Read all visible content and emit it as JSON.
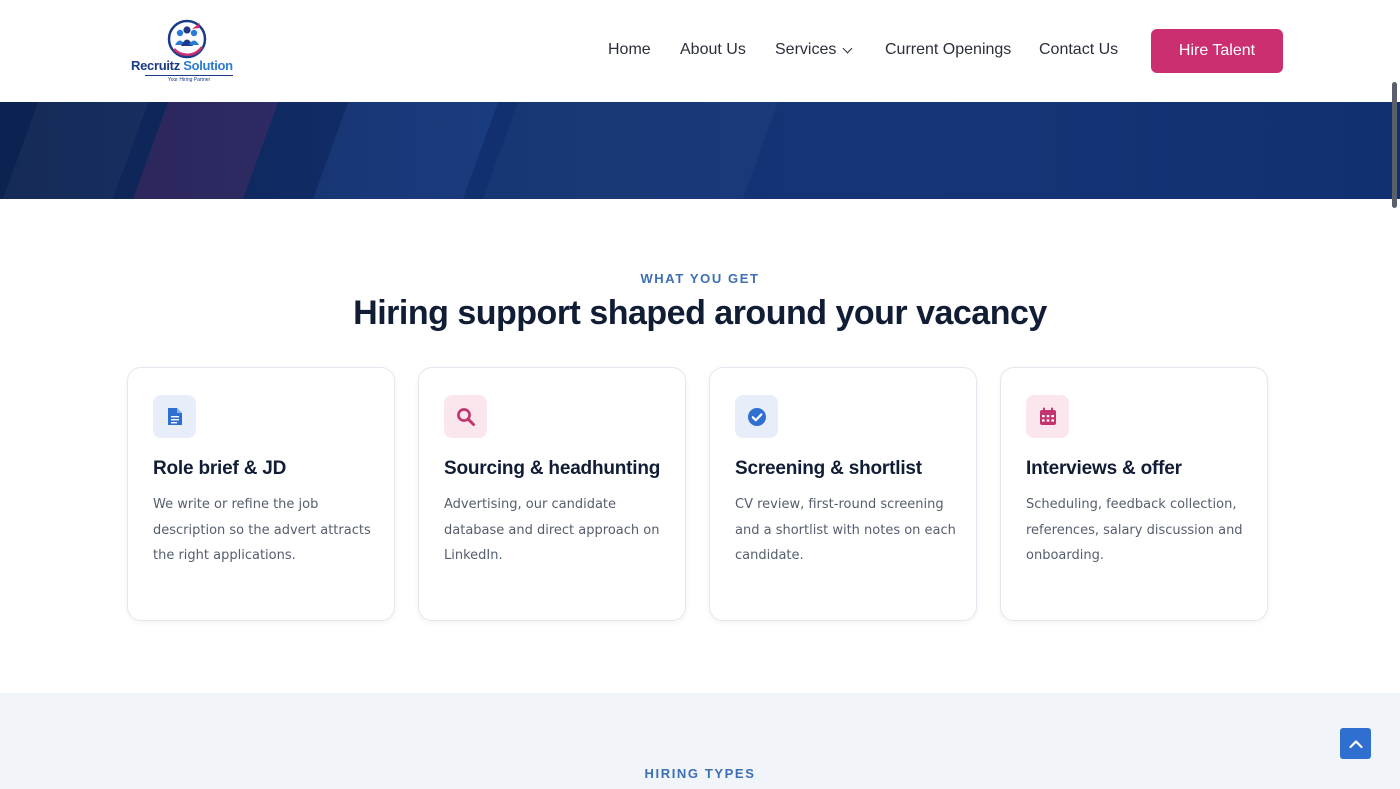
{
  "brand": {
    "name_part1": "Recruitz",
    "name_part2": " Solution",
    "tagline": "Your Hiring Partner"
  },
  "nav": {
    "items": [
      {
        "label": "Home"
      },
      {
        "label": "About Us"
      },
      {
        "label": "Services"
      },
      {
        "label": "Current Openings"
      },
      {
        "label": "Contact Us"
      }
    ],
    "cta_label": "Hire Talent"
  },
  "what_you_get": {
    "eyebrow": "WHAT YOU GET",
    "title": "Hiring support shaped around your vacancy",
    "cards": [
      {
        "icon": "document-icon",
        "title": "Role brief & JD",
        "description": "We write or refine the job description so the advert attracts the right applications."
      },
      {
        "icon": "search-icon",
        "title": "Sourcing & headhunting",
        "description": "Advertising, our candidate database and direct approach on LinkedIn."
      },
      {
        "icon": "check-circle-icon",
        "title": "Screening & shortlist",
        "description": "CV review, first-round screening and a shortlist with notes on each candidate."
      },
      {
        "icon": "calendar-icon",
        "title": "Interviews & offer",
        "description": "Scheduling, feedback collection, references, salary discussion and onboarding."
      }
    ]
  },
  "hiring_types": {
    "eyebrow": "HIRING TYPES"
  },
  "colors": {
    "accent_pink": "#cc2f6f",
    "accent_blue": "#2f6fd0",
    "hero_navy": "#12306f",
    "icon_blue": "#2f6fd0",
    "icon_pink": "#c2336f"
  },
  "icons": {
    "scroll_top": "chevron-up-icon"
  }
}
